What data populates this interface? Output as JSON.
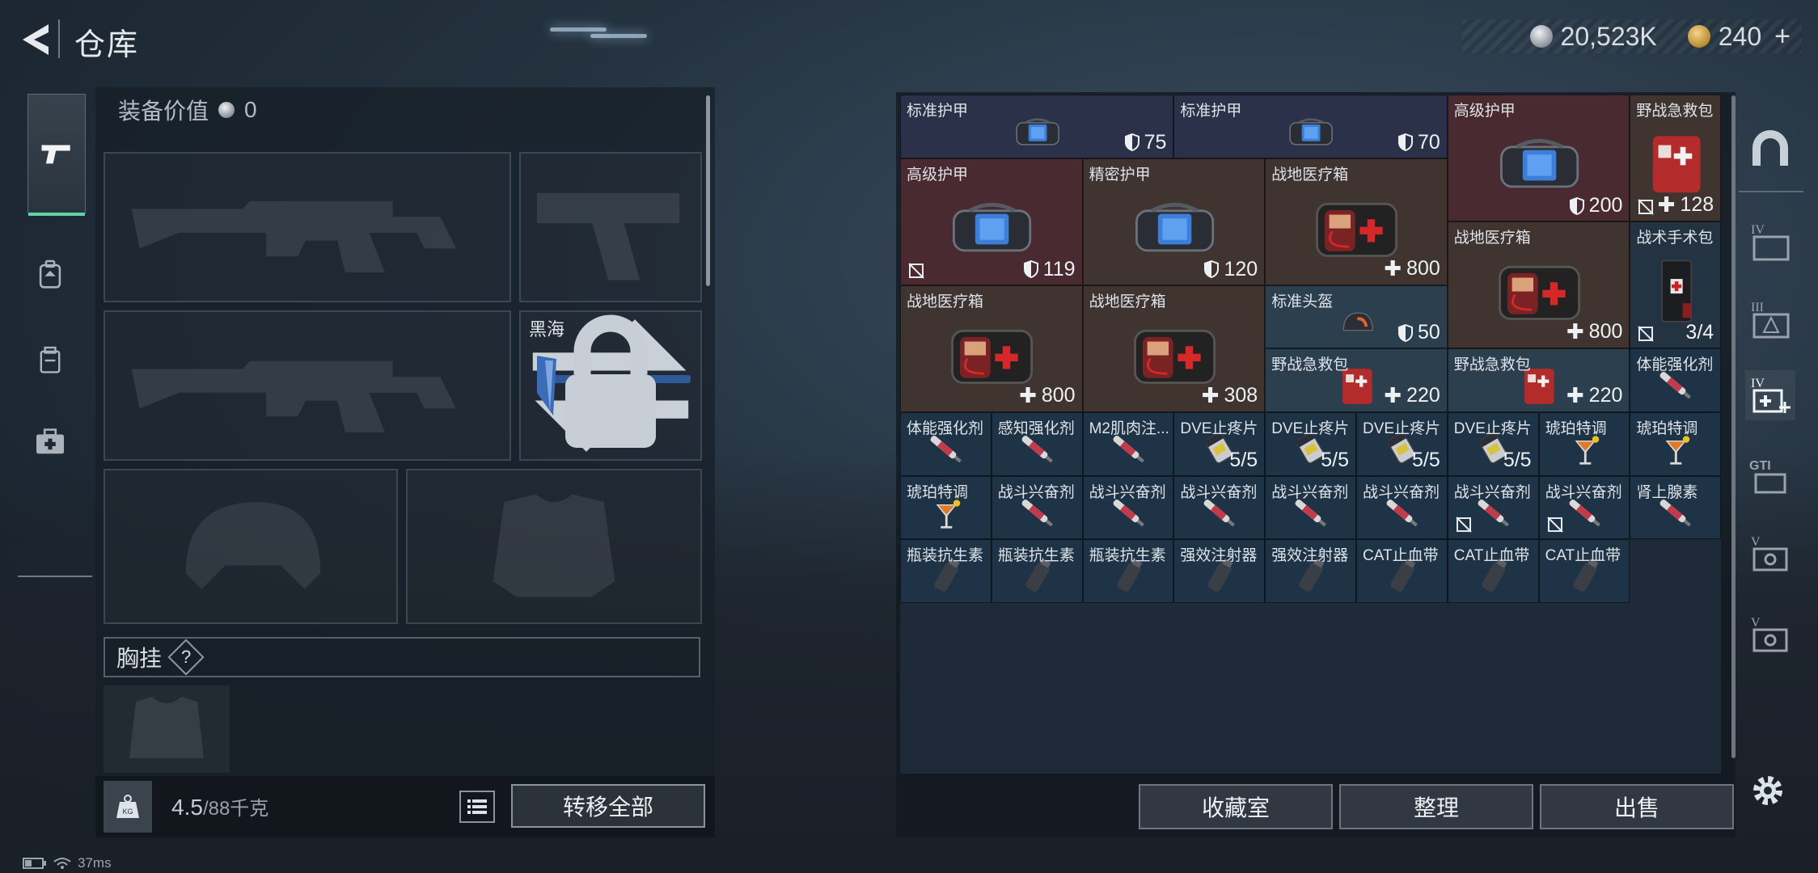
{
  "topbar": {
    "title": "仓库",
    "silver": "20,523K",
    "gold": "240",
    "gold_plus": "+"
  },
  "equipment": {
    "value_label": "装备价值",
    "value": "0",
    "melee_name": "黑海",
    "chest_label": "胸挂",
    "chest_help": "?"
  },
  "footer": {
    "weight_current": "4.5",
    "weight_max": "/88千克",
    "transfer_all": "转移全部"
  },
  "inventory": {
    "items": [
      {
        "name": "标准护甲",
        "stat": "75",
        "stat_icon": "shield-icon",
        "bg": "armor"
      },
      {
        "name": "标准护甲",
        "stat": "70",
        "stat_icon": "shield-icon",
        "bg": "armor"
      },
      {
        "name": "高级护甲",
        "stat": "200",
        "stat_icon": "shield-icon",
        "bg": "armor-high"
      },
      {
        "name": "野战急救包",
        "stat": "128",
        "stat_icon": "heal-plus-icon",
        "bg": "med",
        "no_insure": true
      },
      {
        "name": "高级护甲",
        "stat": "119",
        "stat_icon": "shield-icon",
        "bg": "armor-high",
        "no_insure": true
      },
      {
        "name": "精密护甲",
        "stat": "120",
        "stat_icon": "shield-icon",
        "bg": "med"
      },
      {
        "name": "战地医疗箱",
        "stat": "800",
        "stat_icon": "heal-plus-icon",
        "bg": "med"
      },
      {
        "name": "战地医疗箱",
        "stat": "800",
        "stat_icon": "heal-plus-icon",
        "bg": "med"
      },
      {
        "name": "战术手术包",
        "stat": "3/4",
        "stat_icon": "",
        "bg": "drug",
        "no_insure": true
      },
      {
        "name": "战地医疗箱",
        "stat": "800",
        "stat_icon": "heal-plus-icon",
        "bg": "med"
      },
      {
        "name": "战地医疗箱",
        "stat": "308",
        "stat_icon": "heal-plus-icon",
        "bg": "med"
      },
      {
        "name": "标准头盔",
        "stat": "50",
        "stat_icon": "shield-icon",
        "bg": "med2"
      },
      {
        "name": "野战急救包",
        "stat": "220",
        "stat_icon": "heal-plus-icon",
        "bg": "med2"
      },
      {
        "name": "野战急救包",
        "stat": "220",
        "stat_icon": "heal-plus-icon",
        "bg": "med2"
      },
      {
        "name": "体能强化剂",
        "stat": "",
        "bg": "vial"
      },
      {
        "name": "体能强化剂",
        "stat": "",
        "bg": "vial"
      },
      {
        "name": "感知强化剂",
        "stat": "",
        "bg": "vial"
      },
      {
        "name": "M2肌肉注...",
        "stat": "",
        "bg": "vial"
      },
      {
        "name": "DVE止疼片",
        "stat": "5/5",
        "bg": "vial"
      },
      {
        "name": "DVE止疼片",
        "stat": "5/5",
        "bg": "vial"
      },
      {
        "name": "DVE止疼片",
        "stat": "5/5",
        "bg": "vial"
      },
      {
        "name": "DVE止疼片",
        "stat": "5/5",
        "bg": "vial"
      },
      {
        "name": "琥珀特调",
        "stat": "",
        "bg": "vial"
      },
      {
        "name": "琥珀特调",
        "stat": "",
        "bg": "vial"
      },
      {
        "name": "琥珀特调",
        "stat": "",
        "bg": "vial"
      },
      {
        "name": "战斗兴奋剂",
        "stat": "",
        "bg": "vial"
      },
      {
        "name": "战斗兴奋剂",
        "stat": "",
        "bg": "vial"
      },
      {
        "name": "战斗兴奋剂",
        "stat": "",
        "bg": "vial"
      },
      {
        "name": "战斗兴奋剂",
        "stat": "",
        "bg": "vial"
      },
      {
        "name": "战斗兴奋剂",
        "stat": "",
        "bg": "vial"
      },
      {
        "name": "战斗兴奋剂",
        "stat": "",
        "bg": "vial",
        "no_insure": true
      },
      {
        "name": "战斗兴奋剂",
        "stat": "",
        "bg": "vial",
        "no_insure": true
      },
      {
        "name": "肾上腺素",
        "stat": "",
        "bg": "vial"
      },
      {
        "name": "瓶装抗生素",
        "stat": "",
        "bg": "vial"
      },
      {
        "name": "瓶装抗生素",
        "stat": "",
        "bg": "vial"
      },
      {
        "name": "瓶装抗生素",
        "stat": "",
        "bg": "vial"
      },
      {
        "name": "强效注射器",
        "stat": "",
        "bg": "vial"
      },
      {
        "name": "强效注射器",
        "stat": "",
        "bg": "vial"
      },
      {
        "name": "CAT止血带",
        "stat": "",
        "bg": "vial"
      },
      {
        "name": "CAT止血带",
        "stat": "",
        "bg": "vial"
      },
      {
        "name": "CAT止血带",
        "stat": "",
        "bg": "vial"
      }
    ],
    "buttons": {
      "collection": "收藏室",
      "arrange": "整理",
      "sell": "出售"
    }
  },
  "status_bar": {
    "ping": "37ms"
  },
  "colors": {
    "accent_green": "#5fd3a2",
    "armor_bg": "#2b3148",
    "high_armor_bg": "#4a2a31",
    "med_bg": "#3f3430"
  }
}
